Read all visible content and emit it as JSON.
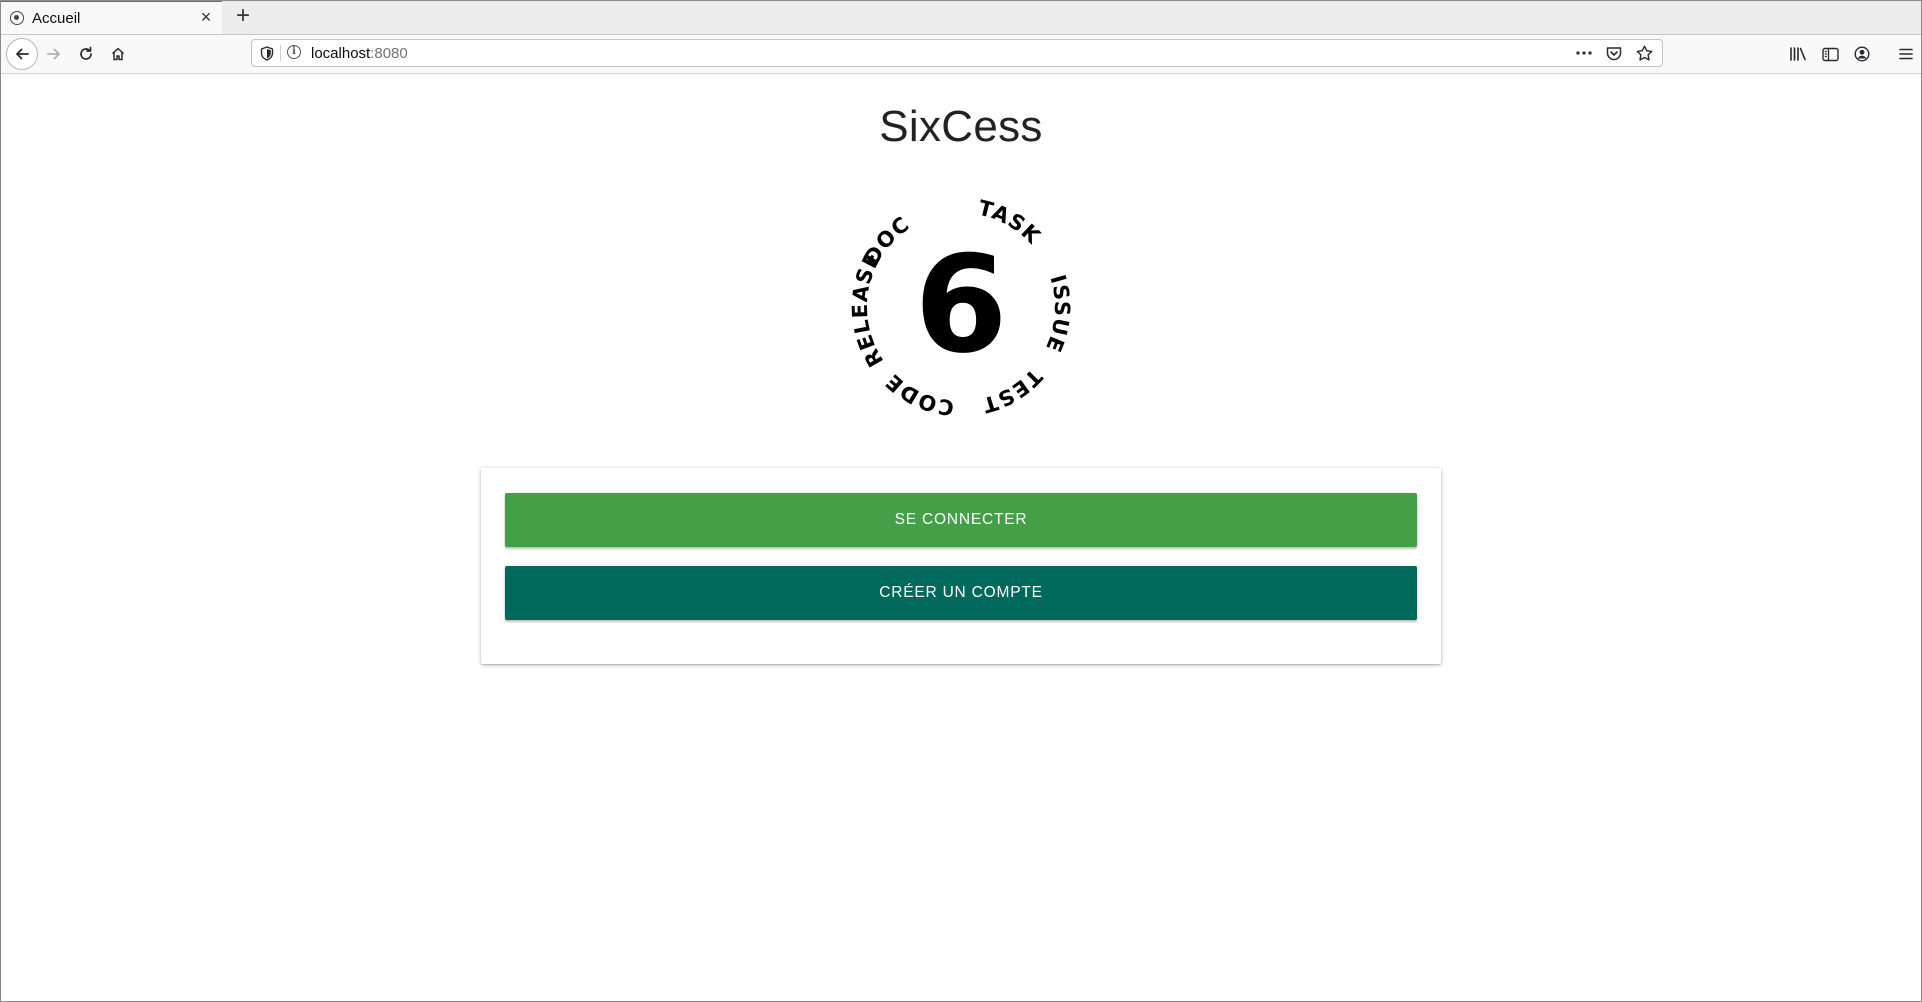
{
  "browser": {
    "tab": {
      "title": "Accueil",
      "favicon": "sixcess-favicon",
      "close": "×"
    },
    "new_tab": "+",
    "url": {
      "host": "localhost",
      "port": ":8080"
    },
    "icons": {
      "back": "back-arrow-icon",
      "forward": "forward-arrow-icon",
      "reload": "reload-icon",
      "home": "home-icon",
      "tracking_protection": "shield-icon",
      "site_info": "info-icon",
      "page_actions": "more-dots-icon",
      "pocket": "pocket-icon",
      "bookmark": "star-icon",
      "library": "library-icon",
      "sidebar": "sidebar-icon",
      "account": "account-icon",
      "menu": "hamburger-menu-icon"
    }
  },
  "page": {
    "title": "SixCess",
    "logo": {
      "center": "6",
      "words": [
        "DOC",
        "TASK",
        "ISSUE",
        "TEST",
        "CODE",
        "RELEASE"
      ]
    },
    "buttons": {
      "login": "SE CONNECTER",
      "register": "CRÉER UN COMPTE"
    }
  },
  "colors": {
    "login_button": "#43a047",
    "register_button": "#00695c",
    "tab_accent": "#0a84ff"
  }
}
